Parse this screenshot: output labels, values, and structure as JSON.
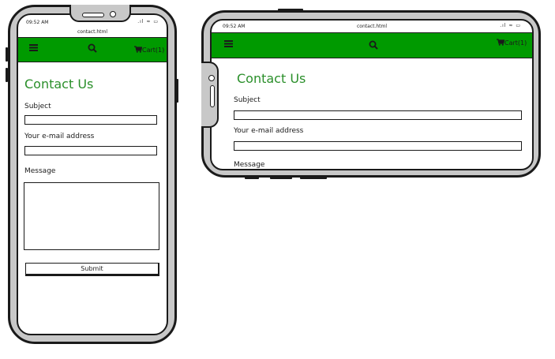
{
  "status": {
    "time": "09:52 AM",
    "icons": ".ıl ≈ ▭"
  },
  "browser": {
    "url": "contact.html"
  },
  "nav": {
    "cart_label": "Cart(1)"
  },
  "page": {
    "title": "Contact Us",
    "subject_label": "Subject",
    "email_label": "Your e-mail address",
    "message_label": "Message",
    "submit_label": "Submit"
  },
  "colors": {
    "accent": "#009a00",
    "title": "#2a8f2a",
    "frame": "#c8c8c8"
  }
}
